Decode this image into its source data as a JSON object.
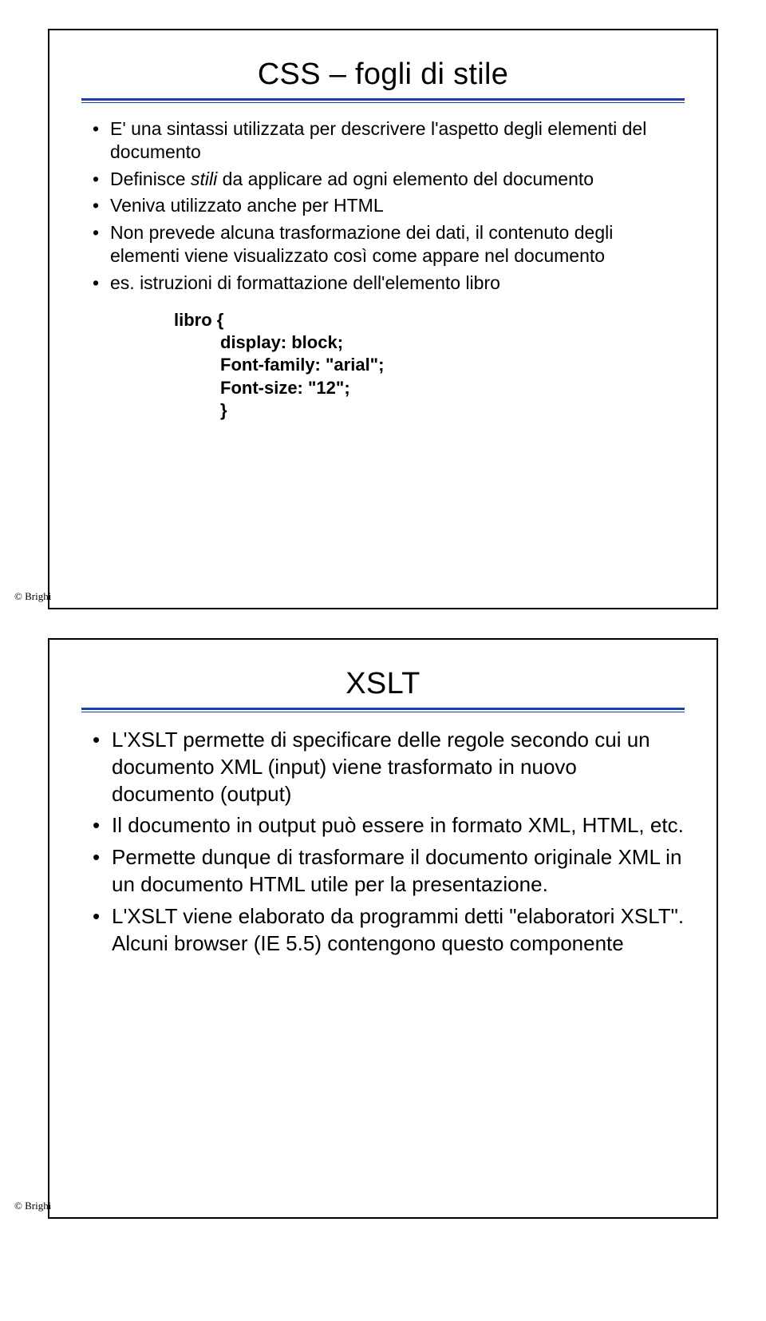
{
  "slide1": {
    "title": "CSS – fogli di stile",
    "bullets": [
      "E' una sintassi utilizzata per descrivere l'aspetto degli elementi del documento",
      "Definisce <span class=\"italic\">stili</span> da applicare ad ogni elemento del documento",
      "Veniva utilizzato anche per HTML",
      "Non prevede alcuna trasformazione dei dati, il contenuto degli elementi viene visualizzato così come appare nel documento",
      "es. istruzioni di formattazione dell'elemento libro"
    ],
    "code": [
      "libro {",
      "display: block;",
      "Font-family: \"arial\";",
      "Font-size: \"12\";",
      "}"
    ],
    "copyright": "© Brighi"
  },
  "slide2": {
    "title": "XSLT",
    "bullets": [
      "L'XSLT permette di specificare delle regole secondo cui un documento XML (input) viene trasformato in nuovo documento (output)",
      "Il documento in output può essere in formato XML, HTML, etc.",
      "Permette dunque di trasformare il documento originale XML in un documento HTML utile per la presentazione.",
      "L'XSLT viene elaborato da programmi detti \"elaboratori XSLT\". Alcuni browser (IE 5.5) contengono questo componente"
    ],
    "copyright": "© Brighi"
  }
}
